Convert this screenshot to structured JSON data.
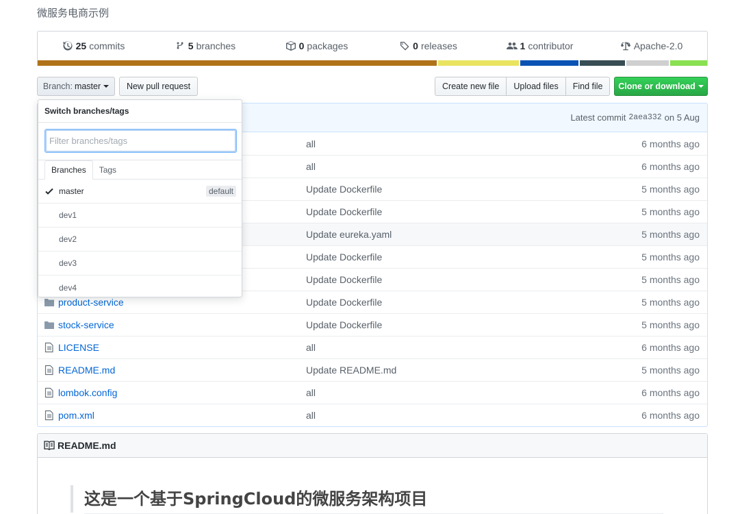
{
  "repo": {
    "description": "微服务电商示例"
  },
  "summary": {
    "items": [
      {
        "num": "25",
        "label": "commits",
        "icon": "history-icon"
      },
      {
        "num": "5",
        "label": "branches",
        "icon": "git-branch-icon"
      },
      {
        "num": "0",
        "label": "packages",
        "icon": "package-icon"
      },
      {
        "num": "0",
        "label": "releases",
        "icon": "tag-icon"
      },
      {
        "num": "1",
        "label": "contributor",
        "icon": "people-icon"
      },
      {
        "num": "",
        "label": "Apache-2.0",
        "icon": "law-icon"
      }
    ],
    "language_colors": [
      "#b07219",
      "#e9e460",
      "#0b53b3",
      "#384d54",
      "#cfcfcf",
      "#89e051"
    ],
    "language_shares": [
      0.602,
      0.122,
      0.088,
      0.068,
      0.064,
      0.056
    ]
  },
  "toolbar": {
    "branch_prefix": "Branch:",
    "branch_name": "master",
    "new_pr": "New pull request",
    "create_file": "Create new file",
    "upload_files": "Upload files",
    "find_file": "Find file",
    "clone": "Clone or download"
  },
  "commit": {
    "prefix": "Latest commit",
    "sha": "2aea332",
    "date": "on 5 Aug"
  },
  "files": [
    {
      "name": "",
      "type": "dir",
      "message": "all",
      "age": "6 months ago"
    },
    {
      "name": "",
      "type": "dir",
      "message": "all",
      "age": "6 months ago"
    },
    {
      "name": "",
      "type": "dir",
      "message": "Update Dockerfile",
      "age": "5 months ago"
    },
    {
      "name": "",
      "type": "dir",
      "message": "Update Dockerfile",
      "age": "5 months ago"
    },
    {
      "name": "",
      "type": "dir",
      "message": "Update eureka.yaml",
      "age": "5 months ago"
    },
    {
      "name": "",
      "type": "dir",
      "message": "Update Dockerfile",
      "age": "5 months ago"
    },
    {
      "name": "",
      "type": "dir",
      "message": "Update Dockerfile",
      "age": "5 months ago"
    },
    {
      "name": "product-service",
      "type": "dir",
      "message": "Update Dockerfile",
      "age": "5 months ago"
    },
    {
      "name": "stock-service",
      "type": "dir",
      "message": "Update Dockerfile",
      "age": "5 months ago"
    },
    {
      "name": "LICENSE",
      "type": "file",
      "message": "all",
      "age": "6 months ago"
    },
    {
      "name": "README.md",
      "type": "file",
      "message": "Update README.md",
      "age": "5 months ago"
    },
    {
      "name": "lombok.config",
      "type": "file",
      "message": "all",
      "age": "6 months ago"
    },
    {
      "name": "pom.xml",
      "type": "file",
      "message": "all",
      "age": "6 months ago"
    }
  ],
  "readme": {
    "filename": "README.md",
    "heading": "这是一个基于SpringCloud的微服务架构项目"
  },
  "dropdown": {
    "title": "Switch branches/tags",
    "filter_placeholder": "Filter branches/tags",
    "tabs": [
      "Branches",
      "Tags"
    ],
    "default_badge": "default",
    "branches": [
      "master",
      "dev1",
      "dev2",
      "dev3",
      "dev4"
    ]
  }
}
